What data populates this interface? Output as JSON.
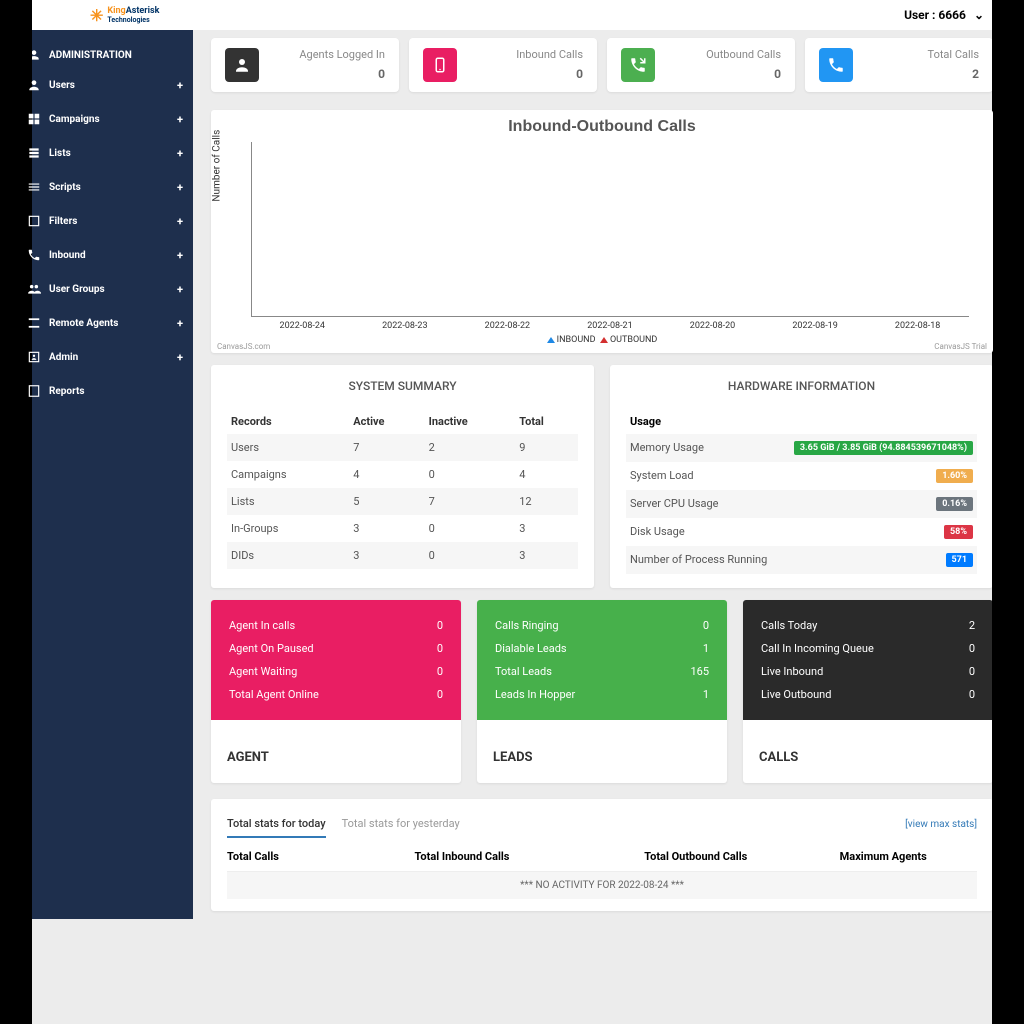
{
  "header": {
    "logo_main": "KingAsterisk",
    "logo_sub": "Technologies",
    "user_label": "User : 6666"
  },
  "sidebar": {
    "heading": "ADMINISTRATION",
    "items": [
      {
        "label": "Users",
        "expandable": true
      },
      {
        "label": "Campaigns",
        "expandable": true
      },
      {
        "label": "Lists",
        "expandable": true
      },
      {
        "label": "Scripts",
        "expandable": true
      },
      {
        "label": "Filters",
        "expandable": true
      },
      {
        "label": "Inbound",
        "expandable": true
      },
      {
        "label": "User Groups",
        "expandable": true
      },
      {
        "label": "Remote Agents",
        "expandable": true
      },
      {
        "label": "Admin",
        "expandable": true
      },
      {
        "label": "Reports",
        "expandable": false
      }
    ]
  },
  "stats": [
    {
      "label": "Agents Logged In",
      "value": "0",
      "color": "ic-black"
    },
    {
      "label": "Inbound Calls",
      "value": "0",
      "color": "ic-pink"
    },
    {
      "label": "Outbound Calls",
      "value": "0",
      "color": "ic-green"
    },
    {
      "label": "Total Calls",
      "value": "2",
      "color": "ic-blue"
    }
  ],
  "chart_data": {
    "type": "line",
    "title": "Inbound-Outbound Calls",
    "ylabel": "Number of Calls",
    "categories": [
      "2022-08-24",
      "2022-08-23",
      "2022-08-22",
      "2022-08-21",
      "2022-08-20",
      "2022-08-19",
      "2022-08-18"
    ],
    "series": [
      {
        "name": "INBOUND",
        "values": [
          0,
          0,
          0,
          0,
          0,
          0,
          0
        ]
      },
      {
        "name": "OUTBOUND",
        "values": [
          0,
          0,
          0,
          0,
          0,
          0,
          0
        ]
      }
    ],
    "footer_left": "CanvasJS.com",
    "footer_right": "CanvasJS Trial"
  },
  "system_summary": {
    "title": "SYSTEM SUMMARY",
    "headers": [
      "Records",
      "Active",
      "Inactive",
      "Total"
    ],
    "rows": [
      [
        "Users",
        "7",
        "2",
        "9"
      ],
      [
        "Campaigns",
        "4",
        "0",
        "4"
      ],
      [
        "Lists",
        "5",
        "7",
        "12"
      ],
      [
        "In-Groups",
        "3",
        "0",
        "3"
      ],
      [
        "DIDs",
        "3",
        "0",
        "3"
      ]
    ]
  },
  "hardware": {
    "title": "HARDWARE INFORMATION",
    "header": "Usage",
    "rows": [
      {
        "label": "Memory Usage",
        "badge": "3.65 GiB / 3.85 GiB (94.884539671048%)",
        "cls": "bg-green"
      },
      {
        "label": "System Load",
        "badge": "1.60%",
        "cls": "bg-yellow"
      },
      {
        "label": "Server CPU Usage",
        "badge": "0.16%",
        "cls": "bg-gray"
      },
      {
        "label": "Disk Usage",
        "badge": "58%",
        "cls": "bg-red"
      },
      {
        "label": "Number of Process Running",
        "badge": "571",
        "cls": "bg-blue"
      }
    ]
  },
  "cards": {
    "agent": {
      "title": "AGENT",
      "rows": [
        {
          "label": "Agent In calls",
          "value": "0"
        },
        {
          "label": "Agent On Paused",
          "value": "0"
        },
        {
          "label": "Agent Waiting",
          "value": "0"
        },
        {
          "label": "Total Agent Online",
          "value": "0"
        }
      ]
    },
    "leads": {
      "title": "LEADS",
      "rows": [
        {
          "label": "Calls Ringing",
          "value": "0"
        },
        {
          "label": "Dialable Leads",
          "value": "1"
        },
        {
          "label": "Total Leads",
          "value": "165"
        },
        {
          "label": "Leads In Hopper",
          "value": "1"
        }
      ]
    },
    "calls": {
      "title": "CALLS",
      "rows": [
        {
          "label": "Calls Today",
          "value": "2"
        },
        {
          "label": "Call In Incoming Queue",
          "value": "0"
        },
        {
          "label": "Live Inbound",
          "value": "0"
        },
        {
          "label": "Live Outbound",
          "value": "0"
        }
      ]
    }
  },
  "bottom": {
    "tab_today": "Total stats for today",
    "tab_yesterday": "Total stats for yesterday",
    "view_max": "[view max stats]",
    "cols": [
      "Total Calls",
      "Total Inbound Calls",
      "Total Outbound Calls",
      "Maximum Agents"
    ],
    "no_activity": "*** NO ACTIVITY FOR 2022-08-24 ***"
  }
}
